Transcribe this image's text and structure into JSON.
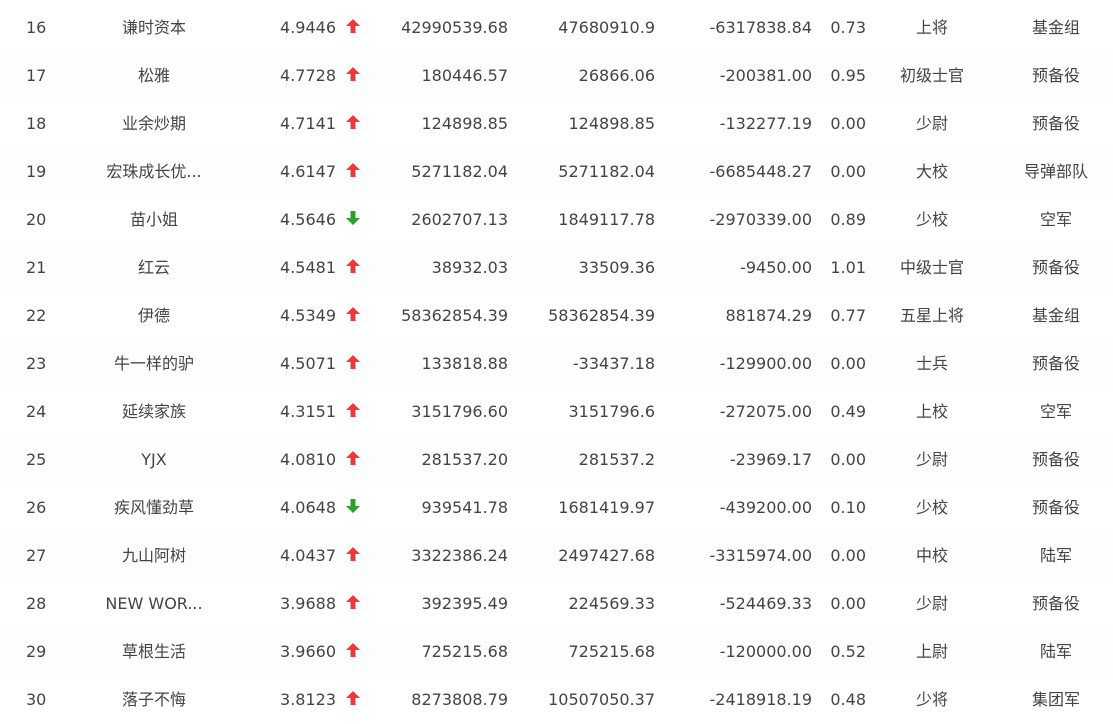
{
  "colors": {
    "text": "#444444",
    "up_arrow": "#e8393d",
    "down_arrow": "#2ca02c"
  },
  "rows": [
    {
      "rank": "16",
      "name": "谦时资本",
      "score": "4.9446",
      "trend": "up",
      "v1": "42990539.68",
      "v2": "47680910.9",
      "v3": "-6317838.84",
      "ratio": "0.73",
      "level": "上将",
      "unit": "基金组"
    },
    {
      "rank": "17",
      "name": "松雅",
      "score": "4.7728",
      "trend": "up",
      "v1": "180446.57",
      "v2": "26866.06",
      "v3": "-200381.00",
      "ratio": "0.95",
      "level": "初级士官",
      "unit": "预备役"
    },
    {
      "rank": "18",
      "name": "业余炒期",
      "score": "4.7141",
      "trend": "up",
      "v1": "124898.85",
      "v2": "124898.85",
      "v3": "-132277.19",
      "ratio": "0.00",
      "level": "少尉",
      "unit": "预备役"
    },
    {
      "rank": "19",
      "name": "宏珠成长优...",
      "score": "4.6147",
      "trend": "up",
      "v1": "5271182.04",
      "v2": "5271182.04",
      "v3": "-6685448.27",
      "ratio": "0.00",
      "level": "大校",
      "unit": "导弹部队"
    },
    {
      "rank": "20",
      "name": "苗小姐",
      "score": "4.5646",
      "trend": "down",
      "v1": "2602707.13",
      "v2": "1849117.78",
      "v3": "-2970339.00",
      "ratio": "0.89",
      "level": "少校",
      "unit": "空军"
    },
    {
      "rank": "21",
      "name": "红云",
      "score": "4.5481",
      "trend": "up",
      "v1": "38932.03",
      "v2": "33509.36",
      "v3": "-9450.00",
      "ratio": "1.01",
      "level": "中级士官",
      "unit": "预备役"
    },
    {
      "rank": "22",
      "name": "伊德",
      "score": "4.5349",
      "trend": "up",
      "v1": "58362854.39",
      "v2": "58362854.39",
      "v3": "881874.29",
      "ratio": "0.77",
      "level": "五星上将",
      "unit": "基金组"
    },
    {
      "rank": "23",
      "name": "牛一样的驴",
      "score": "4.5071",
      "trend": "up",
      "v1": "133818.88",
      "v2": "-33437.18",
      "v3": "-129900.00",
      "ratio": "0.00",
      "level": "士兵",
      "unit": "预备役"
    },
    {
      "rank": "24",
      "name": "延续家族",
      "score": "4.3151",
      "trend": "up",
      "v1": "3151796.60",
      "v2": "3151796.6",
      "v3": "-272075.00",
      "ratio": "0.49",
      "level": "上校",
      "unit": "空军"
    },
    {
      "rank": "25",
      "name": "YJX",
      "score": "4.0810",
      "trend": "up",
      "v1": "281537.20",
      "v2": "281537.2",
      "v3": "-23969.17",
      "ratio": "0.00",
      "level": "少尉",
      "unit": "预备役"
    },
    {
      "rank": "26",
      "name": "疾风懂劲草",
      "score": "4.0648",
      "trend": "down",
      "v1": "939541.78",
      "v2": "1681419.97",
      "v3": "-439200.00",
      "ratio": "0.10",
      "level": "少校",
      "unit": "预备役"
    },
    {
      "rank": "27",
      "name": "九山阿树",
      "score": "4.0437",
      "trend": "up",
      "v1": "3322386.24",
      "v2": "2497427.68",
      "v3": "-3315974.00",
      "ratio": "0.00",
      "level": "中校",
      "unit": "陆军"
    },
    {
      "rank": "28",
      "name": "NEW WOR...",
      "score": "3.9688",
      "trend": "up",
      "v1": "392395.49",
      "v2": "224569.33",
      "v3": "-524469.33",
      "ratio": "0.00",
      "level": "少尉",
      "unit": "预备役"
    },
    {
      "rank": "29",
      "name": "草根生活",
      "score": "3.9660",
      "trend": "up",
      "v1": "725215.68",
      "v2": "725215.68",
      "v3": "-120000.00",
      "ratio": "0.52",
      "level": "上尉",
      "unit": "陆军"
    },
    {
      "rank": "30",
      "name": "落子不悔",
      "score": "3.8123",
      "trend": "up",
      "v1": "8273808.79",
      "v2": "10507050.37",
      "v3": "-2418918.19",
      "ratio": "0.48",
      "level": "少将",
      "unit": "集团军"
    }
  ]
}
